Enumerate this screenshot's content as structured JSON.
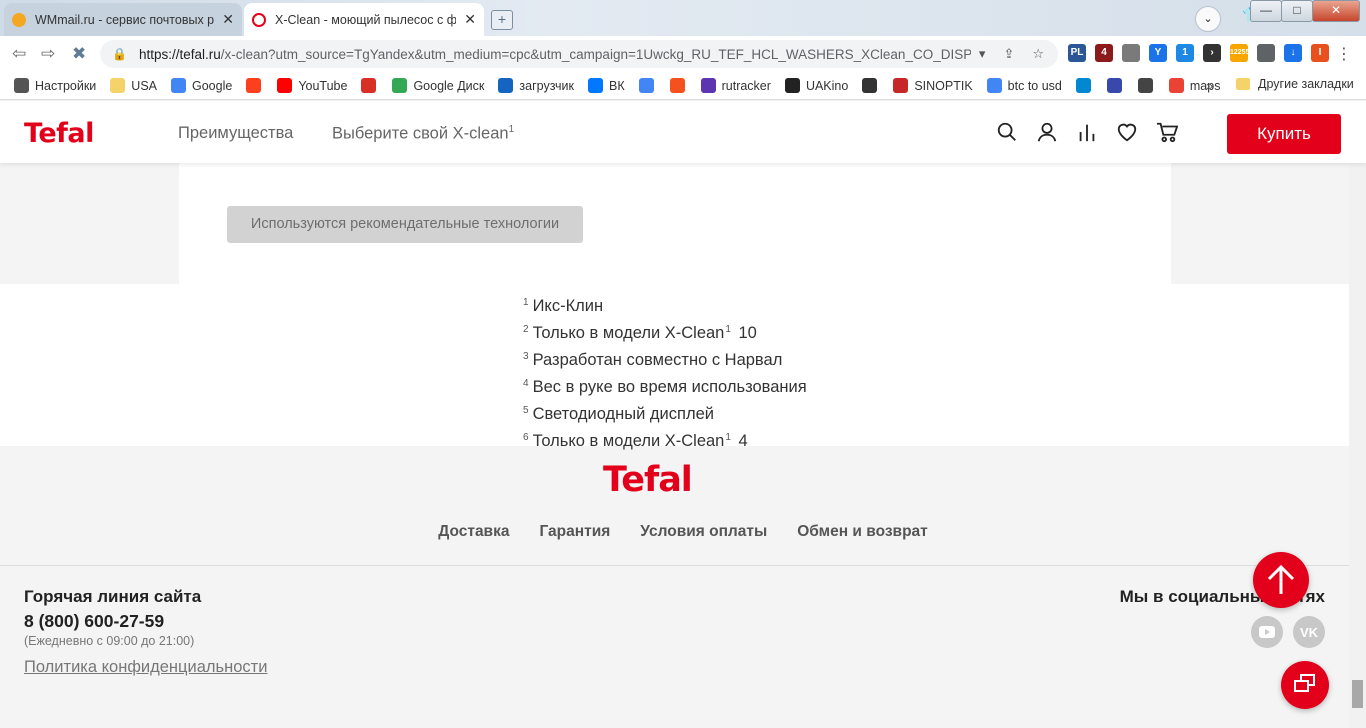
{
  "browser": {
    "tabs": [
      {
        "title": "WMmail.ru - сервис почтовых рас",
        "favicon_color": "#f5a623",
        "active": false
      },
      {
        "title": "X-Clean - моющий пылесос с фун",
        "favicon_color": "#e2001a",
        "active": true
      }
    ],
    "new_tab": "+",
    "profile_initial": "",
    "window_controls": {
      "minimize": "—",
      "maximize": "□",
      "close": "✕"
    },
    "nav": {
      "back": "⇦",
      "forward": "⇨",
      "stop": "✖"
    },
    "url_host": "https://tefal.ru",
    "url_rest": "/x-clean?utm_source=TgYandex&utm_medium=cpc&utm_campaign=1Uwckg_RU_TEF_HCL_WASHERS_XClean_CO_DISP_S...",
    "extensions": [
      {
        "label": "PL",
        "color": "#2b5797"
      },
      {
        "label": "4",
        "color": "#8b1a1a"
      },
      {
        "label": "",
        "color": "#7a7a7a"
      },
      {
        "label": "Y",
        "color": "#1a73e8"
      },
      {
        "label": "1",
        "color": "#1e88e5"
      },
      {
        "label": "›",
        "color": "#333333"
      },
      {
        "label": "12255",
        "color": "#f7a600"
      },
      {
        "label": "",
        "color": "#5f6368"
      },
      {
        "label": "↓",
        "color": "#1a73e8"
      },
      {
        "label": "I",
        "color": "#e8501e"
      }
    ],
    "bookmarks": [
      {
        "label": "Настройки",
        "icon": "gear-icon",
        "color": "#555555"
      },
      {
        "label": "USA",
        "icon": "folder-icon",
        "color": "#f5d36a"
      },
      {
        "label": "Google",
        "icon": "google-icon",
        "color": "#4285f4"
      },
      {
        "label": "",
        "icon": "yandex-icon",
        "color": "#fc3f1d"
      },
      {
        "label": "YouTube",
        "icon": "youtube-icon",
        "color": "#ff0000"
      },
      {
        "label": "",
        "icon": "gmail-icon",
        "color": "#d93025"
      },
      {
        "label": "Google Диск",
        "icon": "drive-icon",
        "color": "#34a853"
      },
      {
        "label": "загрузчик",
        "icon": "loop-icon",
        "color": "#1565c0"
      },
      {
        "label": "ВК",
        "icon": "vk-icon",
        "color": "#0077ff"
      },
      {
        "label": "",
        "icon": "translate-icon",
        "color": "#4285f4"
      },
      {
        "label": "",
        "icon": "f-icon",
        "color": "#f4511e"
      },
      {
        "label": "rutracker",
        "icon": "rutracker-icon",
        "color": "#5e35b1"
      },
      {
        "label": "UAKino",
        "icon": "uakino-icon",
        "color": "#222222"
      },
      {
        "label": "",
        "icon": "chess-icon",
        "color": "#333333"
      },
      {
        "label": "SINOPTIK",
        "icon": "thermometer-icon",
        "color": "#c62828"
      },
      {
        "label": "btc to usd",
        "icon": "google-icon",
        "color": "#4285f4"
      },
      {
        "label": "",
        "icon": "p-icon",
        "color": "#0288d1"
      },
      {
        "label": "",
        "icon": "arrow-icon",
        "color": "#3949ab"
      },
      {
        "label": "",
        "icon": "bc-icon",
        "color": "#444444"
      },
      {
        "label": "maps",
        "icon": "maps-icon",
        "color": "#ea4335"
      }
    ],
    "bookmarks_more": "»",
    "other_bookmarks": "Другие закладки"
  },
  "site": {
    "logo": "Tefal",
    "nav": [
      {
        "label": "Преимущества"
      },
      {
        "label": "Выберите свой X-clean",
        "sup": "1"
      }
    ],
    "header_icons": [
      "search-icon",
      "user-icon",
      "compare-icon",
      "heart-icon",
      "cart-icon"
    ],
    "buy_label": "Купить",
    "recommend_label": "Используются рекомендательные технологии",
    "footnotes": [
      {
        "n": "1",
        "text": "Икс-Клин",
        "inner_sup": "",
        "tail": ""
      },
      {
        "n": "2",
        "text": "Только в модели X-Clean",
        "inner_sup": "1",
        "tail": " 10"
      },
      {
        "n": "3",
        "text": "Разработан совместно с Нарвал",
        "inner_sup": "",
        "tail": ""
      },
      {
        "n": "4",
        "text": "Вес в руке во время использования",
        "inner_sup": "",
        "tail": ""
      },
      {
        "n": "5",
        "text": "Светодиодный дисплей",
        "inner_sup": "",
        "tail": ""
      },
      {
        "n": "6",
        "text": "Только в модели X-Clean",
        "inner_sup": "1",
        "tail": " 4"
      }
    ],
    "footer": {
      "logo": "Tefal",
      "links": [
        "Доставка",
        "Гарантия",
        "Условия оплаты",
        "Обмен и возврат"
      ],
      "hotline_title": "Горячая линия сайта",
      "hotline_phone": "8 (800) 600-27-59",
      "hotline_hours": "(Ежедневно с 09:00 до 21:00)",
      "privacy": "Политика конфиденциальности",
      "social_title": "Мы в социальных сетях",
      "social": [
        "youtube-icon",
        "vk-icon"
      ]
    },
    "colors": {
      "brand": "#e2001a",
      "footer_bg": "#f4f4f4",
      "page_bg": "#ffffff"
    }
  }
}
